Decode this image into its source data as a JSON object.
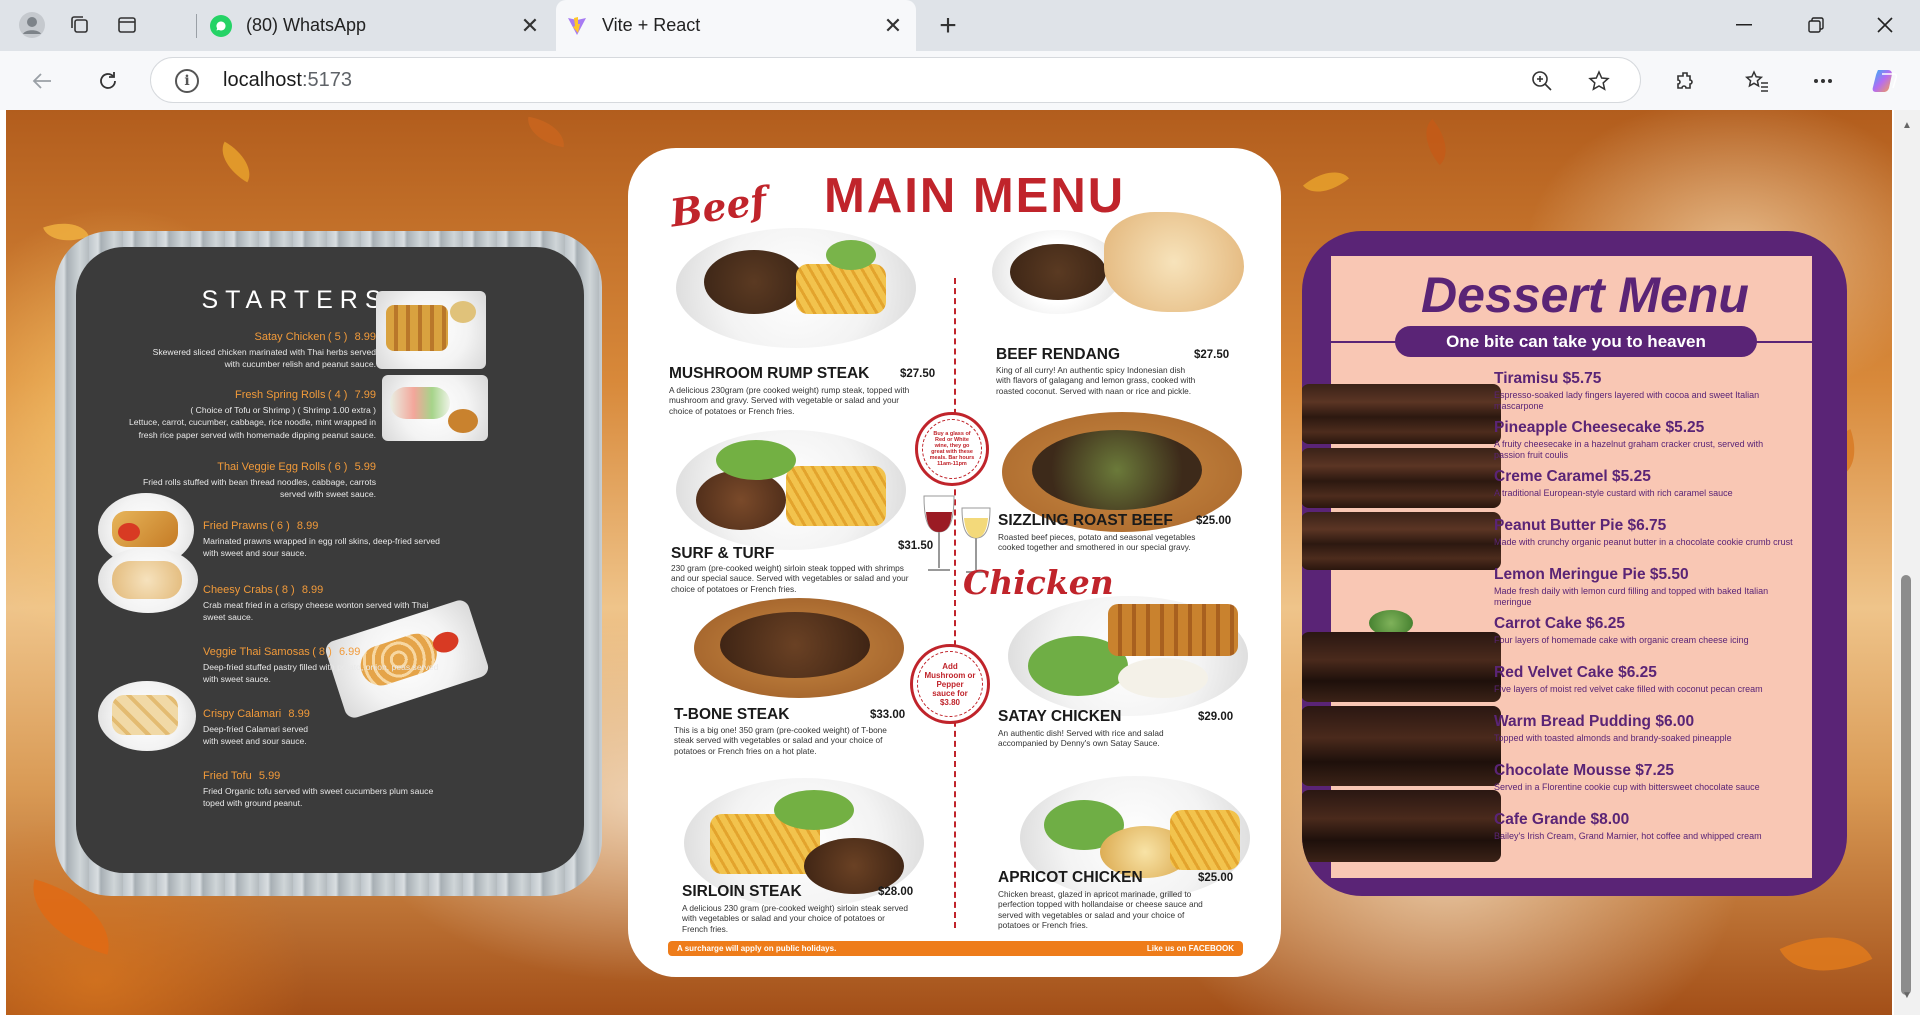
{
  "browser": {
    "tabs": [
      {
        "title": "(80) WhatsApp",
        "active": false,
        "icon": "whatsapp-icon",
        "color": "#25d366"
      },
      {
        "title": "Vite + React",
        "active": true,
        "icon": "vite-icon",
        "color": "#8e6cf6"
      }
    ],
    "address": {
      "host": "localhost",
      "port": ":5173"
    }
  },
  "starters": {
    "title": "STARTERS",
    "items": [
      {
        "name": "Satay Chicken",
        "qty": "( 5 )",
        "price": "8.99",
        "desc1": "Skewered sliced chicken marinated with Thai herbs served",
        "desc2": "with cucumber relish and peanut sauce."
      },
      {
        "name": "Fresh Spring Rolls",
        "qty": "( 4 )",
        "price": "7.99",
        "desc1": "( Choice of Tofu or Shrimp ) ( Shrimp 1.00 extra )",
        "desc2": "Lettuce, carrot, cucumber, cabbage, rice noodle, mint wrapped in",
        "desc3": "fresh rice paper served with homemade dipping peanut sauce."
      },
      {
        "name": "Thai Veggie Egg Rolls",
        "qty": "( 6 )",
        "price": "5.99",
        "desc1": "Fried rolls stuffed with bean thread noodles, cabbage, carrots",
        "desc2": "served with sweet sauce."
      },
      {
        "name": "Fried Prawns",
        "qty": "( 6 )",
        "price": "8.99",
        "desc1": "Marinated prawns wrapped in egg roll skins, deep-fried served",
        "desc2": "with sweet and sour sauce."
      },
      {
        "name": "Cheesy Crabs",
        "qty": "( 8 )",
        "price": "8.99",
        "desc1": "Crab meat fried in a crispy cheese wonton served with Thai",
        "desc2": "sweet sauce."
      },
      {
        "name": "Veggie Thai Samosas",
        "qty": "( 8 )",
        "price": "6.99",
        "desc1": "Deep-fried stuffed pastry filled with potato, onion, peas served",
        "desc2": "with sweet sauce."
      },
      {
        "name": "Crispy Calamari",
        "qty": "",
        "price": "8.99",
        "desc1": "Deep-fried Calamari served",
        "desc2": "with sweet and sour sauce."
      },
      {
        "name": "Fried Tofu",
        "qty": "",
        "price": "5.99",
        "desc1": "Fried Organic tofu served with sweet cucumbers plum sauce",
        "desc2": "toped with ground peanut."
      }
    ]
  },
  "main_menu": {
    "title": "MAIN MENU",
    "beef_label": "Beef",
    "chicken_label": "Chicken",
    "dishes": [
      {
        "name": "MUSHROOM RUMP STEAK",
        "price": "$27.50",
        "desc": "A delicious 230gram (pre cooked weight) rump steak, topped with mushroom and gravy. Served with vegetable or salad and your choice of potatoes or French fries."
      },
      {
        "name": "BEEF RENDANG",
        "price": "$27.50",
        "desc": "King of all curry! An authentic spicy Indonesian dish with flavors of galagang and lemon grass, cooked with roasted coconut. Served with naan or rice and pickle."
      },
      {
        "name": "SURF & TURF",
        "price": "$31.50",
        "desc": "230 gram (pre-cooked weight) sirloin steak topped with shrimps and our special sauce. Served with vegetables or salad and your choice of potatoes or French fries."
      },
      {
        "name": "SIZZLING ROAST BEEF",
        "price": "$25.00",
        "desc": "Roasted beef pieces, potato and seasonal vegetables cooked together and smothered in our special gravy."
      },
      {
        "name": "T-BONE STEAK",
        "price": "$33.00",
        "desc": "This is a big one! 350 gram (pre-cooked weight) of T-bone steak served with vegetables or salad and your choice of potatoes or French fries on a hot plate."
      },
      {
        "name": "SATAY CHICKEN",
        "price": "$29.00",
        "desc": "An authentic dish! Served with rice and salad accompanied by Denny's own Satay Sauce."
      },
      {
        "name": "SIRLOIN STEAK",
        "price": "$28.00",
        "desc": "A delicious 230 gram (pre-cooked weight) sirloin steak served with vegetables or salad and your choice of potatoes or French fries."
      },
      {
        "name": "APRICOT CHICKEN",
        "price": "$25.00",
        "desc": "Chicken breast, glazed in apricot marinade, grilled to perfection topped with hollandaise or cheese sauce and served with vegetables or salad and your choice of potatoes or French fries."
      }
    ],
    "badge_wine": "Buy a glass of Red or White wine, they go great with these meals. Bar hours 11am-11pm",
    "badge_sauce": "Add Mushroom or Pepper sauce for $3.80",
    "footer_left": "A surcharge will apply on public holidays.",
    "footer_right": "Like us on FACEBOOK"
  },
  "dessert": {
    "title": "Dessert Menu",
    "tagline": "One bite can take you to heaven",
    "items": [
      {
        "name": "Tiramisu $5.75",
        "desc": "Espresso-soaked lady fingers layered with cocoa and sweet Italian mascarpone"
      },
      {
        "name": "Pineapple Cheesecake $5.25",
        "desc": "A fruity cheesecake in a hazelnut graham cracker crust, served with passion fruit coulis"
      },
      {
        "name": "Creme Caramel $5.25",
        "desc": "A traditional European-style custard with rich caramel sauce"
      },
      {
        "name": "Peanut Butter Pie $6.75",
        "desc": "Made with crunchy organic peanut butter in a chocolate cookie crumb crust"
      },
      {
        "name": "Lemon Meringue Pie $5.50",
        "desc": "Made fresh daily with lemon curd filling and topped with baked Italian meringue"
      },
      {
        "name": "Carrot Cake $6.25",
        "desc": "Four layers of homemade cake  with organic cream cheese icing"
      },
      {
        "name": "Red Velvet Cake $6.25",
        "desc": "Five layers of moist red velvet cake filled with coconut pecan cream"
      },
      {
        "name": "Warm Bread Pudding $6.00",
        "desc": "Topped with toasted almonds and brandy-soaked pineapple"
      },
      {
        "name": "Chocolate Mousse $7.25",
        "desc": "Served in a Florentine cookie cup with bittersweet chocolate sauce"
      },
      {
        "name": "Cafe Grande $8.00",
        "desc": "Bailey's Irish Cream, Grand Marnier, hot coffee and whipped cream"
      }
    ]
  },
  "colors": {
    "menu_red": "#c0242b",
    "dessert_purple": "#5a2476",
    "dessert_bg": "#f9c7b4",
    "starter_price": "#f19a3a",
    "accent_orange": "#ee7c1a"
  }
}
